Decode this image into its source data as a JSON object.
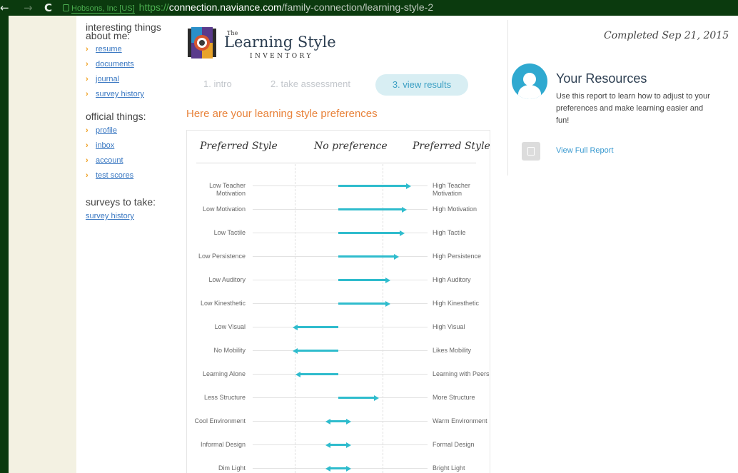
{
  "browser": {
    "back": "←",
    "forward": "→",
    "reload": "C",
    "site_identity": "Hobsons, Inc [US]",
    "url_scheme": "https://",
    "url_host": "connection.naviance.com",
    "url_path": "/family-connection/learning-style-2"
  },
  "sidebar": {
    "interesting_title": "interesting things about me:",
    "interesting_items": [
      {
        "label": "resume"
      },
      {
        "label": "documents"
      },
      {
        "label": "journal"
      },
      {
        "label": "survey history"
      }
    ],
    "official_title": "official things:",
    "official_items": [
      {
        "label": "profile"
      },
      {
        "label": "inbox"
      },
      {
        "label": "account"
      },
      {
        "label": "test scores"
      }
    ],
    "surveys_title": "surveys to take:",
    "surveys_link": "survey history"
  },
  "logo": {
    "the": "The",
    "name": "Learning Style",
    "sub": "INVENTORY"
  },
  "steps": [
    "1. intro",
    "2. take assessment",
    "3. view results"
  ],
  "heading": "Here are your learning style preferences",
  "results": {
    "col_left": "Preferred Style",
    "col_mid": "No preference",
    "col_right": "Preferred Style",
    "rows": [
      {
        "left": "Low Teacher Motivation",
        "right": "High Teacher Motivation",
        "value": 0.75
      },
      {
        "left": "Low Motivation",
        "right": "High Motivation",
        "value": 0.7
      },
      {
        "left": "Low Tactile",
        "right": "High Tactile",
        "value": 0.68
      },
      {
        "left": "Low Persistence",
        "right": "High Persistence",
        "value": 0.62
      },
      {
        "left": "Low Auditory",
        "right": "High Auditory",
        "value": 0.52
      },
      {
        "left": "Low Kinesthetic",
        "right": "High Kinesthetic",
        "value": 0.52
      },
      {
        "left": "Low Visual",
        "right": "High Visual",
        "value": -0.45
      },
      {
        "left": "No Mobility",
        "right": "Likes Mobility",
        "value": -0.45
      },
      {
        "left": "Learning Alone",
        "right": "Learning with Peers",
        "value": -0.42
      },
      {
        "left": "Less Structure",
        "right": "More Structure",
        "value": 0.4
      },
      {
        "left": "Cool Environment",
        "right": "Warm Environment",
        "value": 0.0
      },
      {
        "left": "Informal Design",
        "right": "Formal Design",
        "value": 0.0
      },
      {
        "left": "Dim Light",
        "right": "Bright Light",
        "value": 0.0
      }
    ]
  },
  "completed": "Completed Sep 21, 2015",
  "resources": {
    "title": "Your Resources",
    "desc": "Use this report to learn how to adjust to your preferences and make learning easier and fun!",
    "link": "View Full Report"
  }
}
